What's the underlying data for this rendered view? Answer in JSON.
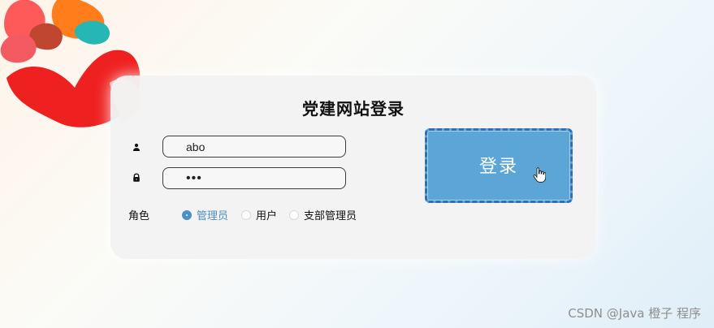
{
  "page": {
    "title": "党建网站登录"
  },
  "form": {
    "username_value": "abo",
    "password_value": "•••",
    "role_label": "角色",
    "roles": [
      {
        "label": "管理员",
        "checked": true
      },
      {
        "label": "用户",
        "checked": false
      },
      {
        "label": "支部管理员",
        "checked": false
      }
    ],
    "login_button_label": "登录"
  },
  "watermark": {
    "text": "CSDN @Java  橙子  程序"
  },
  "colors": {
    "accent": "#4a90c8",
    "button_bg": "#5ba6d7",
    "card_bg": "#f3f3f3"
  },
  "icons": {
    "user": "user-icon",
    "lock": "lock-icon",
    "pointer": "hand-pointer-icon"
  }
}
